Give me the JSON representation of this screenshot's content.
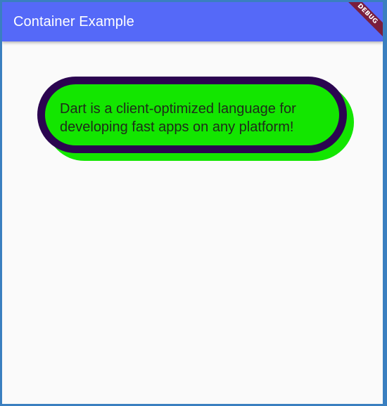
{
  "app_bar": {
    "title": "Container Example",
    "background": "#5569f8"
  },
  "debug_banner": {
    "label": "DEBUG",
    "color": "#7a1e3d"
  },
  "card": {
    "text": "Dart is a client-optimized language for developing fast apps on any platform!",
    "fill_color": "#13e600",
    "border_color": "#2b0550",
    "shadow_color": "#13e600"
  }
}
